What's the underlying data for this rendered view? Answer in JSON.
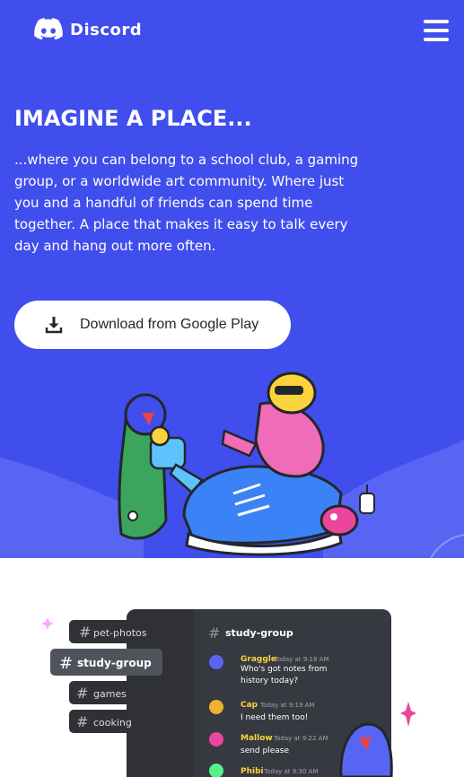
{
  "nav": {
    "brand": "Discord",
    "logo_icon": "discord-logo-icon",
    "menu_icon": "hamburger-menu-icon"
  },
  "hero": {
    "headline": "IMAGINE A PLACE...",
    "body": "...where you can belong to a school club, a gaming group, or a worldwide art community. Where just you and a handful of friends can spend time together. A place that makes it easy to talk every day and hang out more often.",
    "cta_label": "Download from Google Play",
    "cta_icon": "download-icon"
  },
  "colors": {
    "blurple": "#404eed",
    "white": "#ffffff",
    "dark_panel": "#36393f",
    "sidebar": "#2f3136",
    "green": "#57f287",
    "pink": "#eb459e"
  },
  "channels": {
    "sidebar": [
      "pet-photos",
      "study-group",
      "games",
      "cooking"
    ],
    "active": "study-group"
  },
  "chat": {
    "channel": "study-group",
    "messages": [
      {
        "user": "Graggle",
        "time": "Today at 9:18 AM",
        "text": "Who's got notes from history today?"
      },
      {
        "user": "Cap",
        "time": "Today at 9:19 AM",
        "text": "I need them too!"
      },
      {
        "user": "Mallow",
        "time": "Today at 9:22 AM",
        "text": "send please"
      },
      {
        "user": "Phibi",
        "time": "Today at 9:30 AM",
        "text": ""
      }
    ]
  }
}
